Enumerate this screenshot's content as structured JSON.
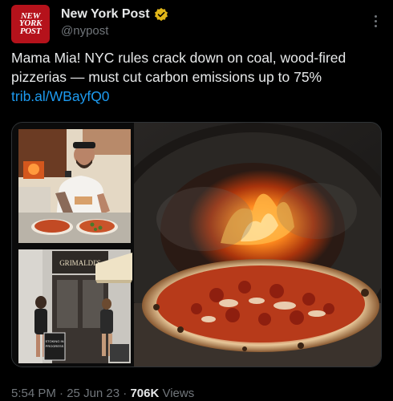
{
  "author": {
    "name": "New York Post",
    "handle": "@nypost",
    "avatar_text": [
      "NEW",
      "YORK",
      "POST"
    ],
    "verified": true,
    "badge_color": "#e2b719",
    "avatar_color": "#b5121b"
  },
  "tweet": {
    "text": "Mama Mia! NYC rules crack down on coal, wood-fired pizzerias — must cut carbon emissions up to 75%",
    "link": "trib.al/WBayfQ0",
    "link_color": "#1d9bf0"
  },
  "media": {
    "images": [
      "pizza-chef-photo",
      "grimaldis-storefront-photo",
      "wood-fired-oven-pizza-photo"
    ],
    "storefront_sign": "GRIMALDI'S",
    "sidewalk_sign": "STOKING IN PROGRESS"
  },
  "meta": {
    "time": "5:54 PM",
    "date": "25 Jun 23",
    "views_count": "706K",
    "views_label": "Views"
  },
  "icons": {
    "more": "more-options-icon",
    "verified": "verified-badge-icon"
  }
}
